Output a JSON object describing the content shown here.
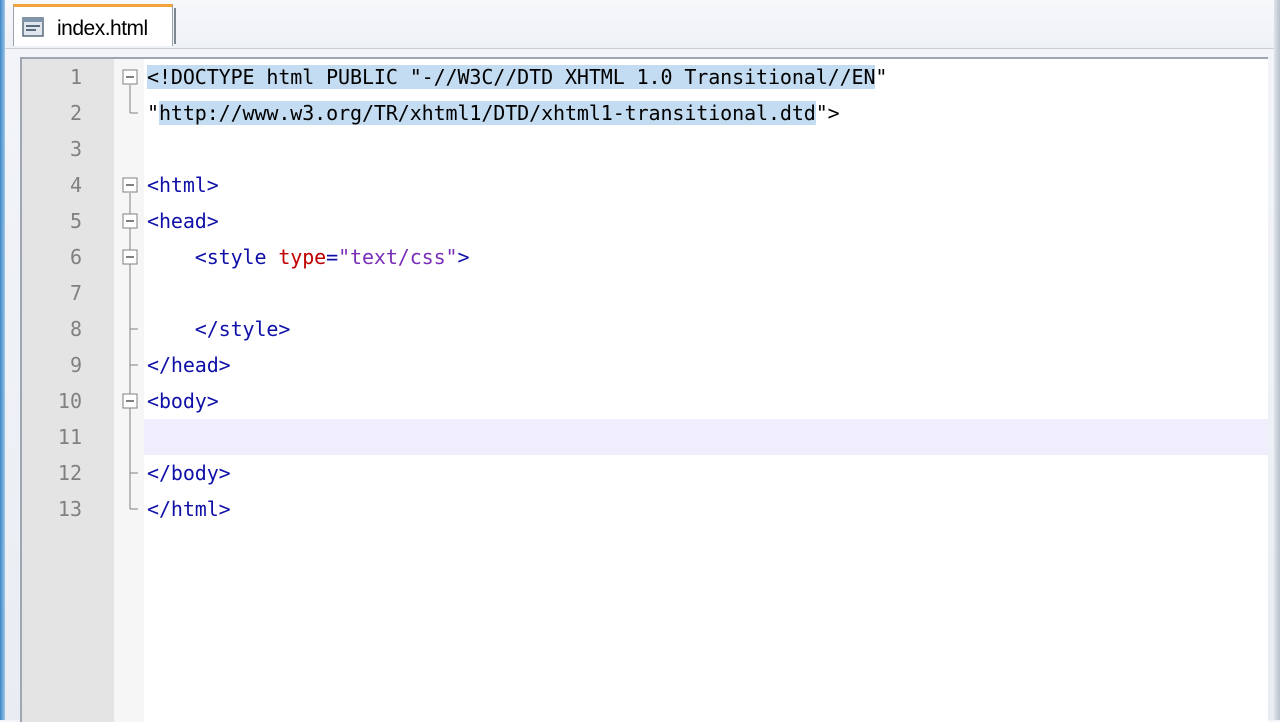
{
  "tab": {
    "label": "index.html",
    "icon": "html-file-icon"
  },
  "colors": {
    "tag": "#1010a8",
    "attribute": "#c00000",
    "string": "#7a2fb8",
    "selection": "#c4dcf1",
    "current_line": "#f0eefc",
    "line_number": "#808080",
    "tab_accent": "#f2a33a"
  },
  "editor": {
    "current_line": 11,
    "lines": [
      {
        "n": "1",
        "segments": [
          {
            "t": "<!DOCTYPE html PUBLIC \"",
            "c": "t-doc",
            "sel": true
          },
          {
            "t": "-//W3C//DTD XHTML 1.0 Transitional//EN",
            "c": "t-doc",
            "sel": true
          },
          {
            "t": "\"",
            "c": "t-doc",
            "sel": false
          }
        ]
      },
      {
        "n": "2",
        "segments": [
          {
            "t": "\"",
            "c": "t-doc",
            "sel": false
          },
          {
            "t": "http://www.w3.org/TR/xhtml1/DTD/xhtml1-transitional.dtd",
            "c": "t-doc",
            "sel": true
          },
          {
            "t": "\">",
            "c": "t-doc",
            "sel": false
          }
        ]
      },
      {
        "n": "3",
        "segments": []
      },
      {
        "n": "4",
        "segments": [
          {
            "t": "<html>",
            "c": "t-tag"
          }
        ]
      },
      {
        "n": "5",
        "segments": [
          {
            "t": "<head>",
            "c": "t-tag"
          }
        ]
      },
      {
        "n": "6",
        "segments": [
          {
            "t": "    <style ",
            "c": "t-tag"
          },
          {
            "t": "type",
            "c": "t-attr"
          },
          {
            "t": "=",
            "c": "t-tag"
          },
          {
            "t": "\"text/css\"",
            "c": "t-str"
          },
          {
            "t": ">",
            "c": "t-tag"
          }
        ]
      },
      {
        "n": "7",
        "segments": []
      },
      {
        "n": "8",
        "segments": [
          {
            "t": "    </style>",
            "c": "t-tag"
          }
        ]
      },
      {
        "n": "9",
        "segments": [
          {
            "t": "</head>",
            "c": "t-tag"
          }
        ]
      },
      {
        "n": "10",
        "segments": [
          {
            "t": "<body>",
            "c": "t-tag"
          }
        ]
      },
      {
        "n": "11",
        "segments": []
      },
      {
        "n": "12",
        "segments": [
          {
            "t": "</body>",
            "c": "t-tag"
          }
        ]
      },
      {
        "n": "13",
        "segments": [
          {
            "t": "</html>",
            "c": "t-tag"
          }
        ]
      }
    ]
  }
}
